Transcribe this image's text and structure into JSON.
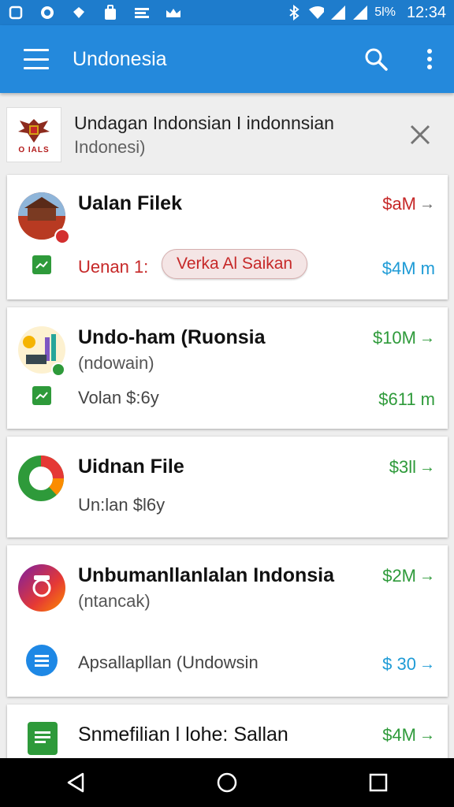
{
  "status_bar": {
    "battery": "5l%",
    "time": "12:34"
  },
  "app_bar": {
    "title": "Undonesia"
  },
  "banner": {
    "flag_text": "O IALS",
    "title": "Undagan Indonsian I indonnsian",
    "subtitle": "Indonesi)"
  },
  "cards": [
    {
      "title": "Ualan Filek",
      "price_top": "$aM",
      "row_label": "Uenan 1:",
      "chip_label": "Verka Al Saikan",
      "price_bottom": "$4M m"
    },
    {
      "title": "Undo-ham (Ruonsia",
      "subtitle": "(ndowain)",
      "price_top": "$10M",
      "row_text": "Volan $:6y",
      "price_bottom": "$611 m"
    },
    {
      "title": "Uidnan File",
      "price_top": "$3ll",
      "row_text": "Un:lan $l6y"
    },
    {
      "title": "Unbumanllanlalan Indonsia",
      "subtitle": "(ntancak)",
      "price_top": "$2M",
      "row_text": "Apsallapllan (Undowsin",
      "price_bottom": "$ 30"
    },
    {
      "title": "Snmefilian l lohe: Sallan",
      "price_top": "$4M"
    }
  ],
  "colors": {
    "primary": "#2489dc",
    "status_bar": "#1e7ccc",
    "red": "#c62828",
    "green": "#2e9a3a",
    "blue": "#1e9bd6"
  }
}
